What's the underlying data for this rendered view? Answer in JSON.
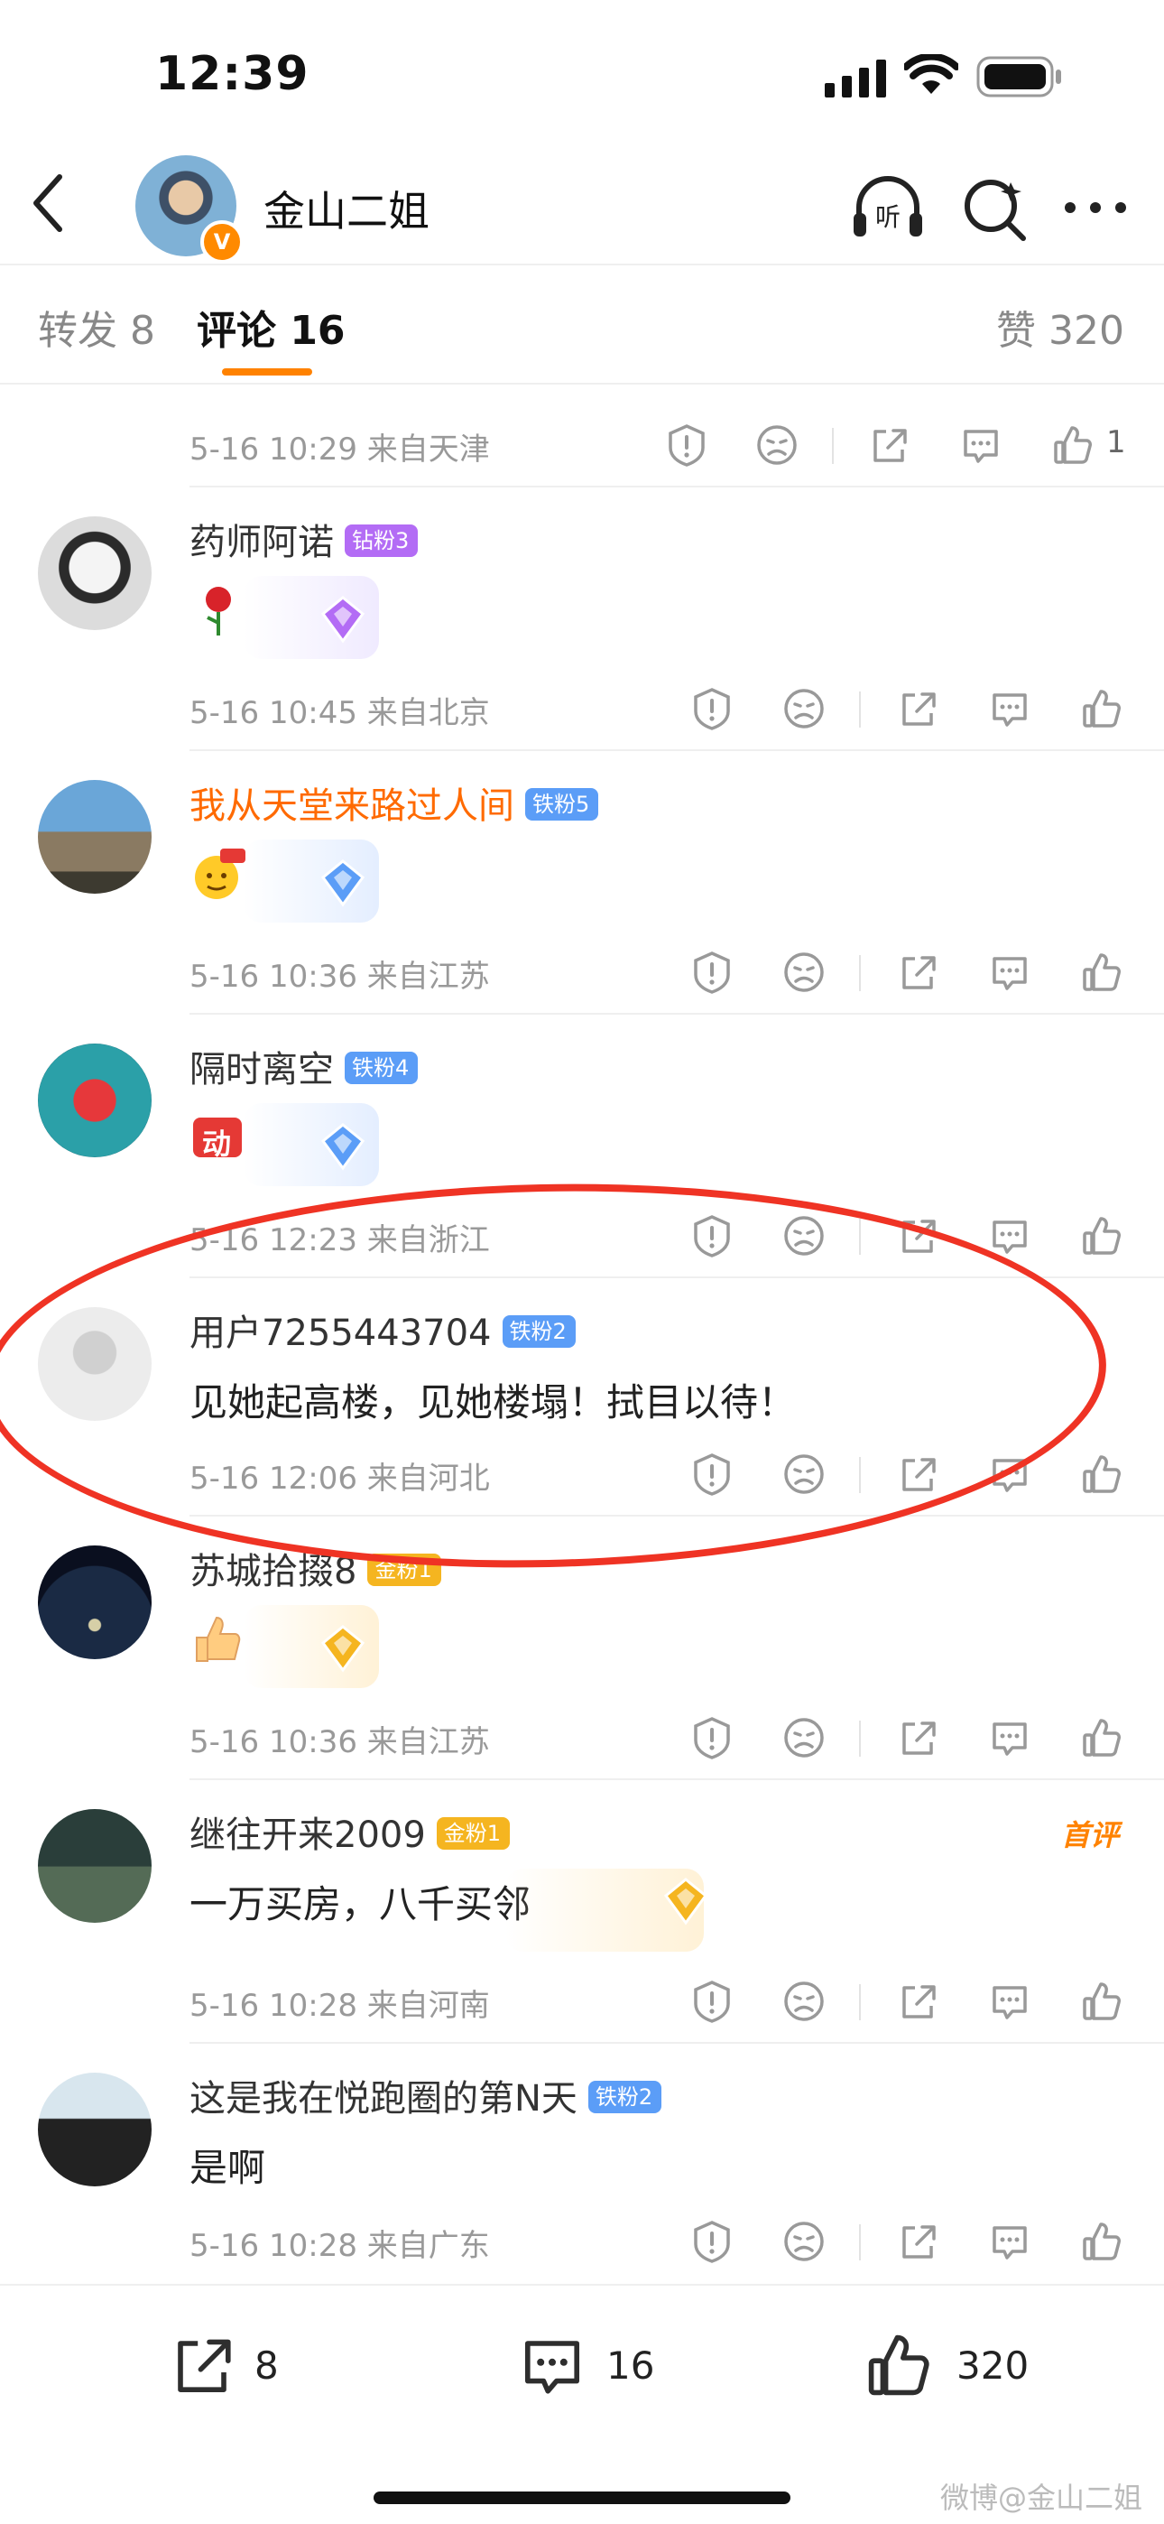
{
  "status": {
    "time": "12:39"
  },
  "nav": {
    "title": "金山二姐",
    "listen_label": "听"
  },
  "tabs": {
    "reposts": "转发 8",
    "comments": "评论 16",
    "likes": "赞 320"
  },
  "top_meta": {
    "meta": "5-16 10:29  来自天津",
    "like_count": "1"
  },
  "comments": [
    {
      "name": "药师阿诺",
      "badge": "钻粉3",
      "badge_color": "#b36cf5",
      "meta": "5-16 10:45  来自北京",
      "emoji": "rose"
    },
    {
      "name": "我从天堂来路过人间",
      "badge": "铁粉5",
      "badge_color": "#5b9df7",
      "meta": "5-16 10:36  来自江苏",
      "emoji": "666-face"
    },
    {
      "name": "隔时离空",
      "badge": "铁粉4",
      "badge_color": "#5b9df7",
      "meta": "5-16 12:23  来自浙江",
      "emoji": "move-sticker",
      "emoji_text": "动"
    },
    {
      "name": "用户7255443704",
      "badge": "铁粉2",
      "badge_color": "#5b9df7",
      "text": "见她起高楼，见她楼塌！拭目以待！",
      "meta": "5-16 12:06  来自河北"
    },
    {
      "name": "苏城拾掇8",
      "badge": "金粉1",
      "badge_color": "#f5b520",
      "meta": "5-16 10:36  来自江苏",
      "emoji": "thumbs-up"
    },
    {
      "name": "继往开来2009",
      "badge": "金粉1",
      "badge_color": "#f5b520",
      "text": "一万买房，八千买邻",
      "meta": "5-16 10:28  来自河南",
      "tag": "首评"
    },
    {
      "name": "这是我在悦跑圈的第N天",
      "badge": "铁粉2",
      "badge_color": "#5b9df7",
      "text": "是啊",
      "meta": "5-16 10:28  来自广东"
    }
  ],
  "bottom": {
    "reposts": "8",
    "comments": "16",
    "likes": "320"
  },
  "watermark": "微博@金山二姐",
  "colors": {
    "accent": "#ff8200",
    "annotation": "#ef3324"
  }
}
